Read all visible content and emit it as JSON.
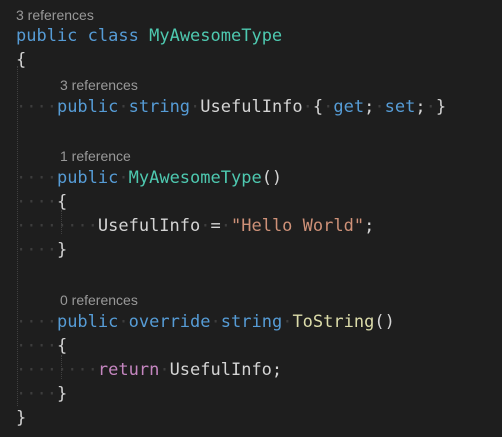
{
  "lenses": {
    "class_refs": "3 references",
    "prop_refs": "3 references",
    "ctor_refs": "1 reference",
    "tostring_refs": "0 references"
  },
  "code": {
    "l1": {
      "kw1": "public",
      "kw2": "class",
      "type": "MyAwesomeType"
    },
    "l2": {
      "brace": "{"
    },
    "l3": {
      "kw1": "public",
      "kw2": "string",
      "prop": "UsefulInfo",
      "open": "{",
      "get": "get",
      "semi1": ";",
      "set": "set",
      "semi2": ";",
      "close": "}"
    },
    "l4": {
      "kw1": "public",
      "type": "MyAwesomeType",
      "parens": "()"
    },
    "l5": {
      "brace": "{"
    },
    "l6": {
      "prop": "UsefulInfo",
      "eq": "=",
      "str": "\"Hello World\"",
      "semi": ";"
    },
    "l7": {
      "brace": "}"
    },
    "l8": {
      "kw1": "public",
      "kw2": "override",
      "kw3": "string",
      "method": "ToString",
      "parens": "()"
    },
    "l9": {
      "brace": "{"
    },
    "l10": {
      "ret": "return",
      "prop": "UsefulInfo",
      "semi": ";"
    },
    "l11": {
      "brace": "}"
    },
    "l12": {
      "brace": "}"
    }
  },
  "colors": {
    "background": "#1e1e1e",
    "keyword": "#569cd6",
    "control_keyword": "#c586c0",
    "type": "#4ec9b0",
    "method": "#dcdcaa",
    "string": "#ce9178",
    "text": "#d4d4d4",
    "codelens": "#999999"
  }
}
